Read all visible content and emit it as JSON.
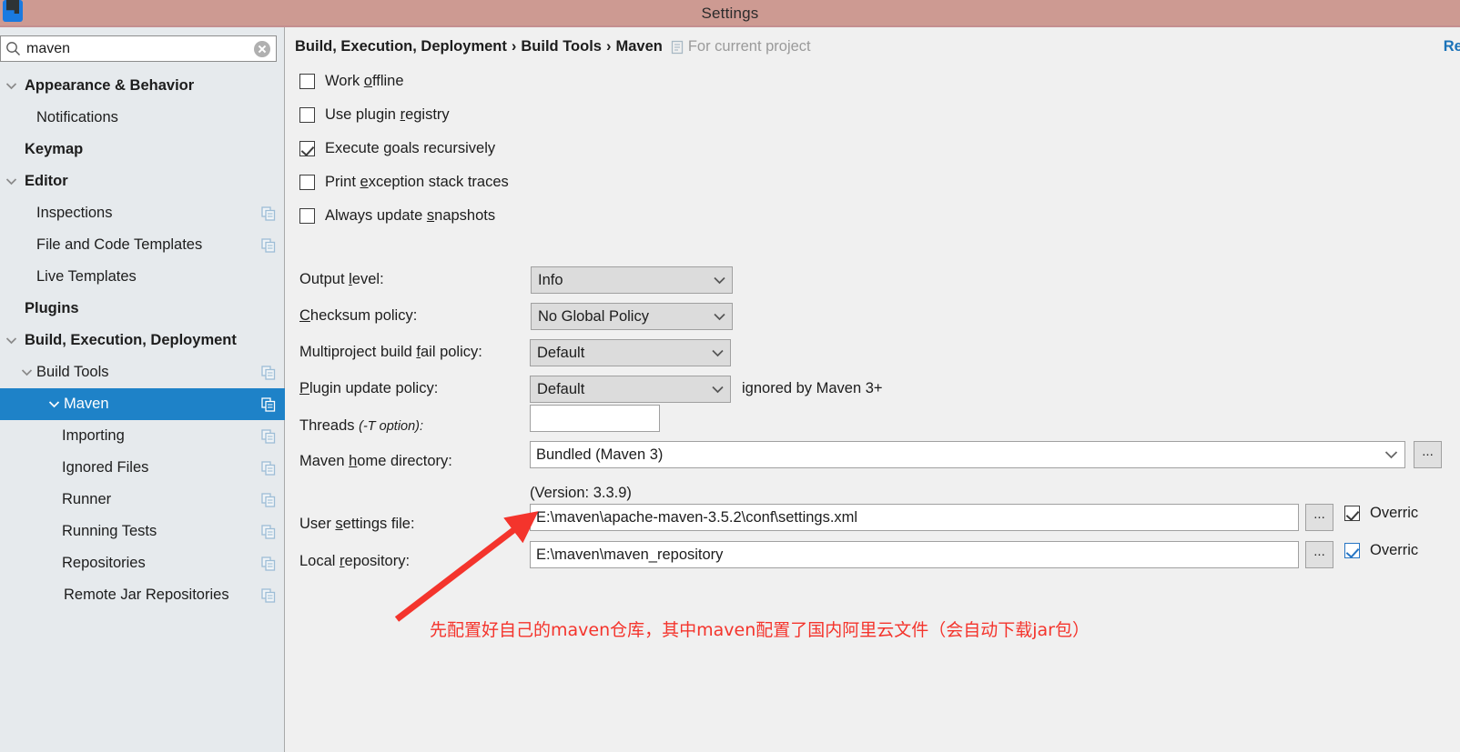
{
  "window": {
    "title": "Settings",
    "app_icon": "intellij-idea-icon",
    "titlebar_color": "#cd9a92"
  },
  "search": {
    "value": "maven",
    "placeholder": "Search settings",
    "icon": "search-icon",
    "clear_icon": "clear-circle-icon"
  },
  "sidebar": {
    "background": "#e6eaed",
    "selection_color": "#1e82c8",
    "items": [
      {
        "label": "Appearance & Behavior",
        "indent": 0,
        "bold": true,
        "arrow": "chevron-down",
        "copy": false,
        "selected": false
      },
      {
        "label": "Notifications",
        "indent": 1,
        "bold": false,
        "arrow": "none",
        "copy": false,
        "selected": false
      },
      {
        "label": "Keymap",
        "indent": 0,
        "bold": true,
        "arrow": "none",
        "copy": false,
        "selected": false
      },
      {
        "label": "Editor",
        "indent": 0,
        "bold": true,
        "arrow": "chevron-down",
        "copy": false,
        "selected": false
      },
      {
        "label": "Inspections",
        "indent": 1,
        "bold": false,
        "arrow": "none",
        "copy": true,
        "selected": false
      },
      {
        "label": "File and Code Templates",
        "indent": 1,
        "bold": false,
        "arrow": "none",
        "copy": true,
        "selected": false
      },
      {
        "label": "Live Templates",
        "indent": 1,
        "bold": false,
        "arrow": "none",
        "copy": false,
        "selected": false
      },
      {
        "label": "Plugins",
        "indent": 0,
        "bold": true,
        "arrow": "none",
        "copy": false,
        "selected": false
      },
      {
        "label": "Build, Execution, Deployment",
        "indent": 0,
        "bold": true,
        "arrow": "chevron-down",
        "copy": false,
        "selected": false
      },
      {
        "label": "Build Tools",
        "indent": 1,
        "bold": false,
        "arrow": "chevron-down",
        "copy": true,
        "selected": false
      },
      {
        "label": "Maven",
        "indent": 2,
        "bold": false,
        "arrow": "chevron-down",
        "copy": true,
        "selected": true
      },
      {
        "label": "Importing",
        "indent": 3,
        "bold": false,
        "arrow": "none",
        "copy": true,
        "selected": false
      },
      {
        "label": "Ignored Files",
        "indent": 3,
        "bold": false,
        "arrow": "none",
        "copy": true,
        "selected": false
      },
      {
        "label": "Runner",
        "indent": 3,
        "bold": false,
        "arrow": "none",
        "copy": true,
        "selected": false
      },
      {
        "label": "Running Tests",
        "indent": 3,
        "bold": false,
        "arrow": "none",
        "copy": true,
        "selected": false
      },
      {
        "label": "Repositories",
        "indent": 3,
        "bold": false,
        "arrow": "none",
        "copy": true,
        "selected": false
      },
      {
        "label": "Remote Jar Repositories",
        "indent": 2,
        "bold": false,
        "arrow": "none",
        "copy": true,
        "selected": false
      }
    ]
  },
  "breadcrumb": {
    "part1": "Build, Execution, Deployment",
    "sep1": "›",
    "part2": "Build Tools",
    "sep2": "›",
    "part3": "Maven",
    "scope_icon": "project-scope-icon",
    "scope": "For current project",
    "reset_link": "Res"
  },
  "checkboxes": [
    {
      "label_pre": "Work ",
      "mnemonic": "o",
      "label_post": "ffline",
      "checked": false,
      "name": "work-offline-checkbox"
    },
    {
      "label_pre": "Use plugin ",
      "mnemonic": "r",
      "label_post": "egistry",
      "checked": false,
      "name": "use-plugin-registry-checkbox"
    },
    {
      "label_pre": "Execute ",
      "mnemonic": "g",
      "label_post": "oals recursively",
      "checked": true,
      "name": "execute-goals-recursively-checkbox"
    },
    {
      "label_pre": "Print ",
      "mnemonic": "e",
      "label_post": "xception stack traces",
      "checked": false,
      "name": "print-exception-stack-traces-checkbox"
    },
    {
      "label_pre": "Always update ",
      "mnemonic": "s",
      "label_post": "napshots",
      "checked": false,
      "name": "always-update-snapshots-checkbox"
    }
  ],
  "fields": {
    "output_level": {
      "label_pre": "Output ",
      "mnemonic": "l",
      "label_post": "evel:",
      "value": "Info"
    },
    "checksum_policy": {
      "label_pre": "",
      "mnemonic": "C",
      "label_post": "hecksum policy:",
      "value": "No Global Policy"
    },
    "multiproject_fail_policy": {
      "label_pre": "Multiproject build ",
      "mnemonic": "f",
      "label_post": "ail policy:",
      "value": "Default"
    },
    "plugin_update_policy": {
      "label_pre": "",
      "mnemonic": "P",
      "label_post": "lugin update policy:",
      "value": "Default",
      "hint": "ignored by Maven 3+"
    },
    "threads": {
      "label_main": "Threads ",
      "label_italic": "(-T option):",
      "value": ""
    },
    "maven_home": {
      "label_pre": "Maven ",
      "mnemonic": "h",
      "label_post": "ome directory:",
      "value": "Bundled (Maven 3)",
      "version_note": "(Version: 3.3.9)"
    },
    "user_settings_file": {
      "label_pre": "User ",
      "mnemonic": "s",
      "label_post": "ettings file:",
      "value": "E:\\maven\\apache-maven-3.5.2\\conf\\settings.xml",
      "browse_label": "...",
      "override_label": "Overric",
      "override_checked": true
    },
    "local_repository": {
      "label_pre": "Local ",
      "mnemonic": "r",
      "label_post": "epository:",
      "value": "E:\\maven\\maven_repository",
      "browse_label": "...",
      "override_label": "Overric",
      "override_checked": true
    }
  },
  "annotation": {
    "text": "先配置好自己的maven仓库，其中maven配置了国内阿里云文件（会自动下载jar包）",
    "color": "#f4342c",
    "arrow": "red-arrow-pointer"
  }
}
